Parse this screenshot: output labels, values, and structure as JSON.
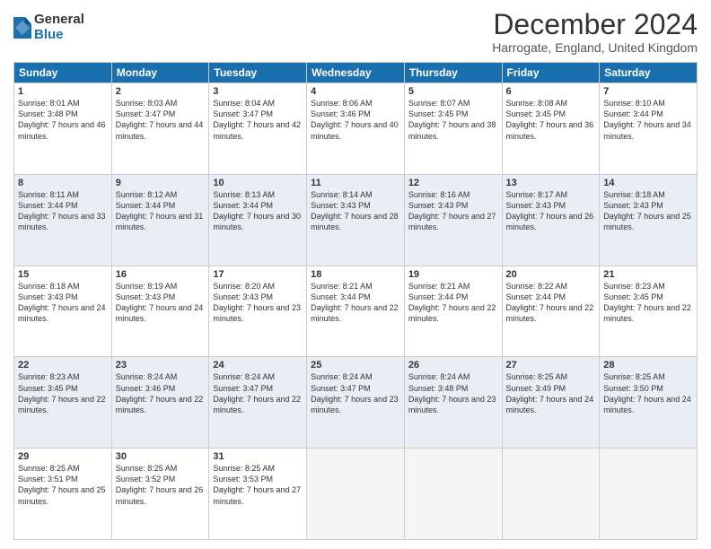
{
  "logo": {
    "general": "General",
    "blue": "Blue"
  },
  "header": {
    "title": "December 2024",
    "location": "Harrogate, England, United Kingdom"
  },
  "days_header": [
    "Sunday",
    "Monday",
    "Tuesday",
    "Wednesday",
    "Thursday",
    "Friday",
    "Saturday"
  ],
  "weeks": [
    [
      {
        "day": "1",
        "sunrise": "Sunrise: 8:01 AM",
        "sunset": "Sunset: 3:48 PM",
        "daylight": "Daylight: 7 hours and 46 minutes."
      },
      {
        "day": "2",
        "sunrise": "Sunrise: 8:03 AM",
        "sunset": "Sunset: 3:47 PM",
        "daylight": "Daylight: 7 hours and 44 minutes."
      },
      {
        "day": "3",
        "sunrise": "Sunrise: 8:04 AM",
        "sunset": "Sunset: 3:47 PM",
        "daylight": "Daylight: 7 hours and 42 minutes."
      },
      {
        "day": "4",
        "sunrise": "Sunrise: 8:06 AM",
        "sunset": "Sunset: 3:46 PM",
        "daylight": "Daylight: 7 hours and 40 minutes."
      },
      {
        "day": "5",
        "sunrise": "Sunrise: 8:07 AM",
        "sunset": "Sunset: 3:45 PM",
        "daylight": "Daylight: 7 hours and 38 minutes."
      },
      {
        "day": "6",
        "sunrise": "Sunrise: 8:08 AM",
        "sunset": "Sunset: 3:45 PM",
        "daylight": "Daylight: 7 hours and 36 minutes."
      },
      {
        "day": "7",
        "sunrise": "Sunrise: 8:10 AM",
        "sunset": "Sunset: 3:44 PM",
        "daylight": "Daylight: 7 hours and 34 minutes."
      }
    ],
    [
      {
        "day": "8",
        "sunrise": "Sunrise: 8:11 AM",
        "sunset": "Sunset: 3:44 PM",
        "daylight": "Daylight: 7 hours and 33 minutes."
      },
      {
        "day": "9",
        "sunrise": "Sunrise: 8:12 AM",
        "sunset": "Sunset: 3:44 PM",
        "daylight": "Daylight: 7 hours and 31 minutes."
      },
      {
        "day": "10",
        "sunrise": "Sunrise: 8:13 AM",
        "sunset": "Sunset: 3:44 PM",
        "daylight": "Daylight: 7 hours and 30 minutes."
      },
      {
        "day": "11",
        "sunrise": "Sunrise: 8:14 AM",
        "sunset": "Sunset: 3:43 PM",
        "daylight": "Daylight: 7 hours and 28 minutes."
      },
      {
        "day": "12",
        "sunrise": "Sunrise: 8:16 AM",
        "sunset": "Sunset: 3:43 PM",
        "daylight": "Daylight: 7 hours and 27 minutes."
      },
      {
        "day": "13",
        "sunrise": "Sunrise: 8:17 AM",
        "sunset": "Sunset: 3:43 PM",
        "daylight": "Daylight: 7 hours and 26 minutes."
      },
      {
        "day": "14",
        "sunrise": "Sunrise: 8:18 AM",
        "sunset": "Sunset: 3:43 PM",
        "daylight": "Daylight: 7 hours and 25 minutes."
      }
    ],
    [
      {
        "day": "15",
        "sunrise": "Sunrise: 8:18 AM",
        "sunset": "Sunset: 3:43 PM",
        "daylight": "Daylight: 7 hours and 24 minutes."
      },
      {
        "day": "16",
        "sunrise": "Sunrise: 8:19 AM",
        "sunset": "Sunset: 3:43 PM",
        "daylight": "Daylight: 7 hours and 24 minutes."
      },
      {
        "day": "17",
        "sunrise": "Sunrise: 8:20 AM",
        "sunset": "Sunset: 3:43 PM",
        "daylight": "Daylight: 7 hours and 23 minutes."
      },
      {
        "day": "18",
        "sunrise": "Sunrise: 8:21 AM",
        "sunset": "Sunset: 3:44 PM",
        "daylight": "Daylight: 7 hours and 22 minutes."
      },
      {
        "day": "19",
        "sunrise": "Sunrise: 8:21 AM",
        "sunset": "Sunset: 3:44 PM",
        "daylight": "Daylight: 7 hours and 22 minutes."
      },
      {
        "day": "20",
        "sunrise": "Sunrise: 8:22 AM",
        "sunset": "Sunset: 3:44 PM",
        "daylight": "Daylight: 7 hours and 22 minutes."
      },
      {
        "day": "21",
        "sunrise": "Sunrise: 8:23 AM",
        "sunset": "Sunset: 3:45 PM",
        "daylight": "Daylight: 7 hours and 22 minutes."
      }
    ],
    [
      {
        "day": "22",
        "sunrise": "Sunrise: 8:23 AM",
        "sunset": "Sunset: 3:45 PM",
        "daylight": "Daylight: 7 hours and 22 minutes."
      },
      {
        "day": "23",
        "sunrise": "Sunrise: 8:24 AM",
        "sunset": "Sunset: 3:46 PM",
        "daylight": "Daylight: 7 hours and 22 minutes."
      },
      {
        "day": "24",
        "sunrise": "Sunrise: 8:24 AM",
        "sunset": "Sunset: 3:47 PM",
        "daylight": "Daylight: 7 hours and 22 minutes."
      },
      {
        "day": "25",
        "sunrise": "Sunrise: 8:24 AM",
        "sunset": "Sunset: 3:47 PM",
        "daylight": "Daylight: 7 hours and 23 minutes."
      },
      {
        "day": "26",
        "sunrise": "Sunrise: 8:24 AM",
        "sunset": "Sunset: 3:48 PM",
        "daylight": "Daylight: 7 hours and 23 minutes."
      },
      {
        "day": "27",
        "sunrise": "Sunrise: 8:25 AM",
        "sunset": "Sunset: 3:49 PM",
        "daylight": "Daylight: 7 hours and 24 minutes."
      },
      {
        "day": "28",
        "sunrise": "Sunrise: 8:25 AM",
        "sunset": "Sunset: 3:50 PM",
        "daylight": "Daylight: 7 hours and 24 minutes."
      }
    ],
    [
      {
        "day": "29",
        "sunrise": "Sunrise: 8:25 AM",
        "sunset": "Sunset: 3:51 PM",
        "daylight": "Daylight: 7 hours and 25 minutes."
      },
      {
        "day": "30",
        "sunrise": "Sunrise: 8:25 AM",
        "sunset": "Sunset: 3:52 PM",
        "daylight": "Daylight: 7 hours and 26 minutes."
      },
      {
        "day": "31",
        "sunrise": "Sunrise: 8:25 AM",
        "sunset": "Sunset: 3:53 PM",
        "daylight": "Daylight: 7 hours and 27 minutes."
      },
      null,
      null,
      null,
      null
    ]
  ]
}
